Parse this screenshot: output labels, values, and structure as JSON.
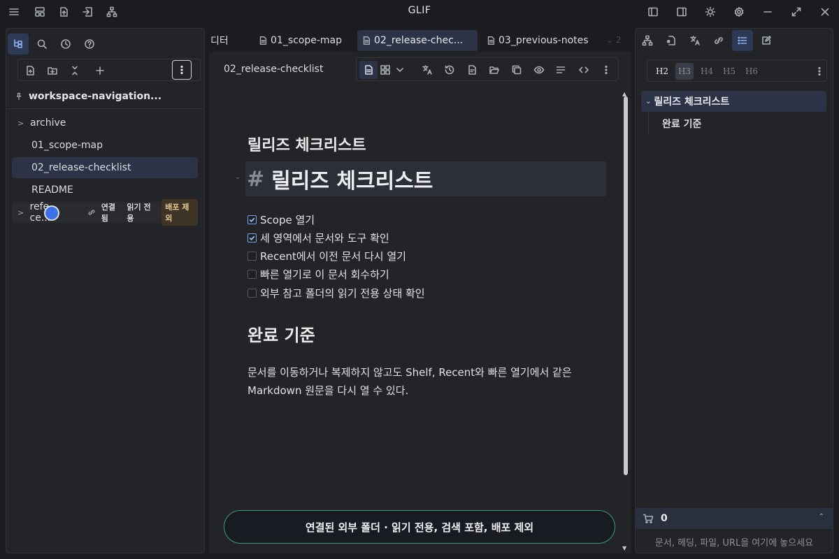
{
  "app": {
    "title": "GLIF"
  },
  "titlebar": {
    "left_icons": [
      "menu-icon",
      "layout-icon",
      "export-icon",
      "import-icon",
      "sitemap-icon"
    ],
    "right_icons": [
      "left-sidebar-icon",
      "right-sidebar-icon",
      "sun-icon",
      "gear-icon",
      "minimize-icon",
      "maximize-icon",
      "close-icon"
    ]
  },
  "left_panel": {
    "tabs": [
      "file-tree-icon",
      "search-icon",
      "clock-icon",
      "help-icon"
    ],
    "toolbar": [
      "new-file-icon",
      "new-folder-icon",
      "collapse-all-icon",
      "plus-icon",
      "more-icon"
    ],
    "workspace": "workspace-navigation...",
    "tree": [
      {
        "label": "archive",
        "type": "folder"
      },
      {
        "label": "01_scope-map",
        "type": "file"
      },
      {
        "label": "02_release-checklist",
        "type": "file",
        "selected": true
      },
      {
        "label": "README",
        "type": "file"
      },
      {
        "label": "refe\u0000ce...",
        "type": "folder"
      }
    ],
    "reference_row": {
      "label": "refe",
      "label_tail": "ce...",
      "badge_linked": "연결됨",
      "badge_readonly": "읽기 전용",
      "badge_excluded": "배포 제외"
    }
  },
  "editor": {
    "tabs": [
      {
        "label": "디터",
        "has_icon": false
      },
      {
        "label": "01_scope-map",
        "has_icon": true
      },
      {
        "label": "02_release-chec...",
        "has_icon": true,
        "active": true
      },
      {
        "label": "03_previous-notes",
        "has_icon": true
      }
    ],
    "tab_overflow": "⌄ 2",
    "doc_title": "02_release-checklist",
    "toolbar": [
      "document-icon",
      "grid-icon",
      "chevron-down-icon",
      "translate-icon",
      "history-icon",
      "file-text-icon",
      "folder-open-icon",
      "copy-icon",
      "eye-icon",
      "align-icon",
      "code-icon",
      "more-icon"
    ],
    "heading_small": "릴리즈 체크리스트",
    "heading_hash": "#",
    "heading_big": "릴리즈 체크리스트",
    "checklist": [
      {
        "text": "Scope 열기",
        "checked": true
      },
      {
        "text": "세 영역에서 문서와 도구 확인",
        "checked": true
      },
      {
        "text": "Recent에서 이전 문서 다시 열기",
        "checked": false
      },
      {
        "text": "빠른 열기로 이 문서 회수하기",
        "checked": false
      },
      {
        "text": "외부 참고 폴더의 읽기 전용 상태 확인",
        "checked": false
      }
    ],
    "heading_done": "완료 기준",
    "paragraph": "문서를 이동하거나 복제하지 않고도 Shelf, Recent와 빠른 열기에서 같은 Markdown 원문을 다시 열 수 있다.",
    "status_banner": "연결된 외부 폴더 · 읽기 전용, 검색 포함, 배포 제외"
  },
  "right_panel": {
    "tabs": [
      "hierarchy-icon",
      "file-link-icon",
      "translate-icon",
      "link-icon",
      "list-icon",
      "edit-icon"
    ],
    "heading_filters": [
      "H2",
      "H3",
      "H4",
      "H5",
      "H6"
    ],
    "outline": [
      {
        "label": "릴리즈 체크리스트",
        "level": 1
      },
      {
        "label": "완료 기준",
        "level": 2
      }
    ],
    "shelf_count": "0",
    "drop_hint": "문서, 헤딩, 파일, URL을 여기에 놓으세요"
  },
  "colors": {
    "accent": "#2d3346",
    "active_icon": "#8fb1f0",
    "banner_border": "#3d9b7a",
    "cursor": "#3c6fe8"
  }
}
